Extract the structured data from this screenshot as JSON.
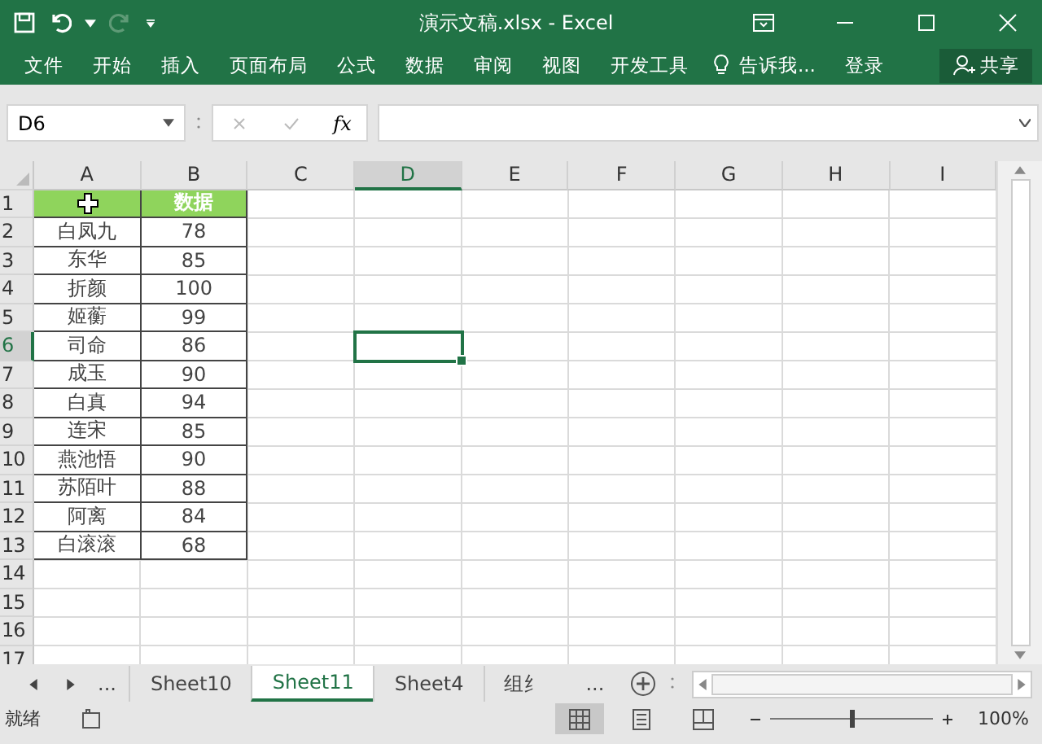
{
  "title_bar": {
    "title": "演示文稿.xlsx - Excel"
  },
  "ribbon": {
    "tabs": [
      {
        "label": "文件"
      },
      {
        "label": "开始"
      },
      {
        "label": "插入"
      },
      {
        "label": "页面布局"
      },
      {
        "label": "公式"
      },
      {
        "label": "数据"
      },
      {
        "label": "审阅"
      },
      {
        "label": "视图"
      },
      {
        "label": "开发工具"
      }
    ],
    "tell_me": "告诉我...",
    "login": "登录",
    "share": "共享"
  },
  "formula_bar": {
    "name_box": "D6",
    "fx": "fx"
  },
  "grid": {
    "columns": [
      {
        "label": "A",
        "selected": false
      },
      {
        "label": "B",
        "selected": false
      },
      {
        "label": "C",
        "selected": false
      },
      {
        "label": "D",
        "selected": true
      },
      {
        "label": "E",
        "selected": false
      },
      {
        "label": "F",
        "selected": false
      },
      {
        "label": "G",
        "selected": false
      },
      {
        "label": "H",
        "selected": false
      },
      {
        "label": "I",
        "selected": false
      }
    ],
    "rows": [
      {
        "label": "1",
        "selected": false,
        "kind": "header",
        "cells": [
          "",
          "数据"
        ]
      },
      {
        "label": "2",
        "selected": false,
        "kind": "data",
        "cells": [
          "白凤九",
          "78"
        ]
      },
      {
        "label": "3",
        "selected": false,
        "kind": "data",
        "cells": [
          "东华",
          "85"
        ]
      },
      {
        "label": "4",
        "selected": false,
        "kind": "data",
        "cells": [
          "折颜",
          "100"
        ]
      },
      {
        "label": "5",
        "selected": false,
        "kind": "data",
        "cells": [
          "姬蘅",
          "99"
        ]
      },
      {
        "label": "6",
        "selected": true,
        "kind": "data",
        "cells": [
          "司命",
          "86"
        ]
      },
      {
        "label": "7",
        "selected": false,
        "kind": "data",
        "cells": [
          "成玉",
          "90"
        ]
      },
      {
        "label": "8",
        "selected": false,
        "kind": "data",
        "cells": [
          "白真",
          "94"
        ]
      },
      {
        "label": "9",
        "selected": false,
        "kind": "data",
        "cells": [
          "连宋",
          "85"
        ]
      },
      {
        "label": "10",
        "selected": false,
        "kind": "data",
        "cells": [
          "燕池悟",
          "90"
        ]
      },
      {
        "label": "11",
        "selected": false,
        "kind": "data",
        "cells": [
          "苏陌叶",
          "88"
        ]
      },
      {
        "label": "12",
        "selected": false,
        "kind": "data",
        "cells": [
          "阿离",
          "84"
        ]
      },
      {
        "label": "13",
        "selected": false,
        "kind": "data",
        "cells": [
          "白滚滚",
          "68"
        ]
      },
      {
        "label": "14",
        "selected": false,
        "kind": "empty"
      },
      {
        "label": "15",
        "selected": false,
        "kind": "empty"
      },
      {
        "label": "16",
        "selected": false,
        "kind": "empty"
      },
      {
        "label": "17",
        "selected": false,
        "kind": "empty"
      }
    ]
  },
  "sheet_tabs": {
    "more": "...",
    "tabs": [
      {
        "label": "Sheet10",
        "selected": false
      },
      {
        "label": "Sheet11",
        "selected": true
      },
      {
        "label": "Sheet4",
        "selected": false
      },
      {
        "label": "组纟",
        "selected": false
      }
    ],
    "more_right": "..."
  },
  "status_bar": {
    "status": "就绪",
    "zoom_slider": {
      "level": 0.5
    },
    "zoom": "100%"
  }
}
